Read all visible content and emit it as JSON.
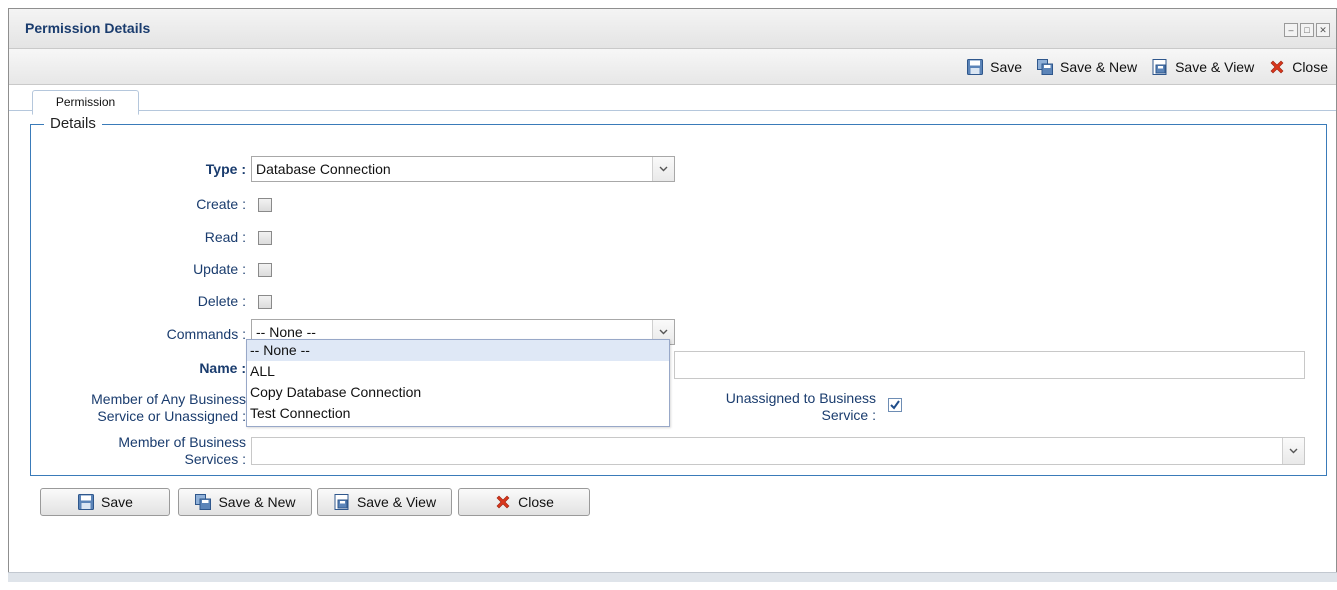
{
  "window": {
    "title": "Permission Details",
    "controls": [
      "minimize-icon",
      "maximize-icon",
      "close-icon"
    ]
  },
  "toolbar": {
    "save_label": "Save",
    "save_new_label": "Save & New",
    "save_view_label": "Save & View",
    "close_label": "Close"
  },
  "tabs": [
    {
      "label": "Permission",
      "active": true
    }
  ],
  "details": {
    "legend": "Details",
    "type": {
      "label": "Type :",
      "value": "Database Connection"
    },
    "create": {
      "label": "Create :",
      "checked": false
    },
    "read": {
      "label": "Read :",
      "checked": false
    },
    "update": {
      "label": "Update :",
      "checked": false
    },
    "delete": {
      "label": "Delete :",
      "checked": false
    },
    "commands": {
      "label": "Commands :",
      "value": "-- None --",
      "options": [
        "-- None --",
        "ALL",
        "Copy Database Connection",
        "Test Connection"
      ],
      "highlighted": "-- None --"
    },
    "name": {
      "label": "Name :",
      "value": ""
    },
    "member_any": {
      "label_line1": "Member of Any Business",
      "label_line2": "Service or Unassigned :"
    },
    "unassigned": {
      "label_line1": "Unassigned to Business",
      "label_line2": "Service :",
      "checked": true
    },
    "member_of": {
      "label_line1": "Member of Business",
      "label_line2": "Services :",
      "value": ""
    }
  },
  "buttons": {
    "save_label": "Save",
    "save_new_label": "Save & New",
    "save_view_label": "Save & View",
    "close_label": "Close"
  },
  "colors": {
    "label_blue": "#1a3c6e",
    "fieldset_border": "#3a7bb9",
    "selected_option": "#dfe8f6",
    "close_red": "#d9361c"
  }
}
